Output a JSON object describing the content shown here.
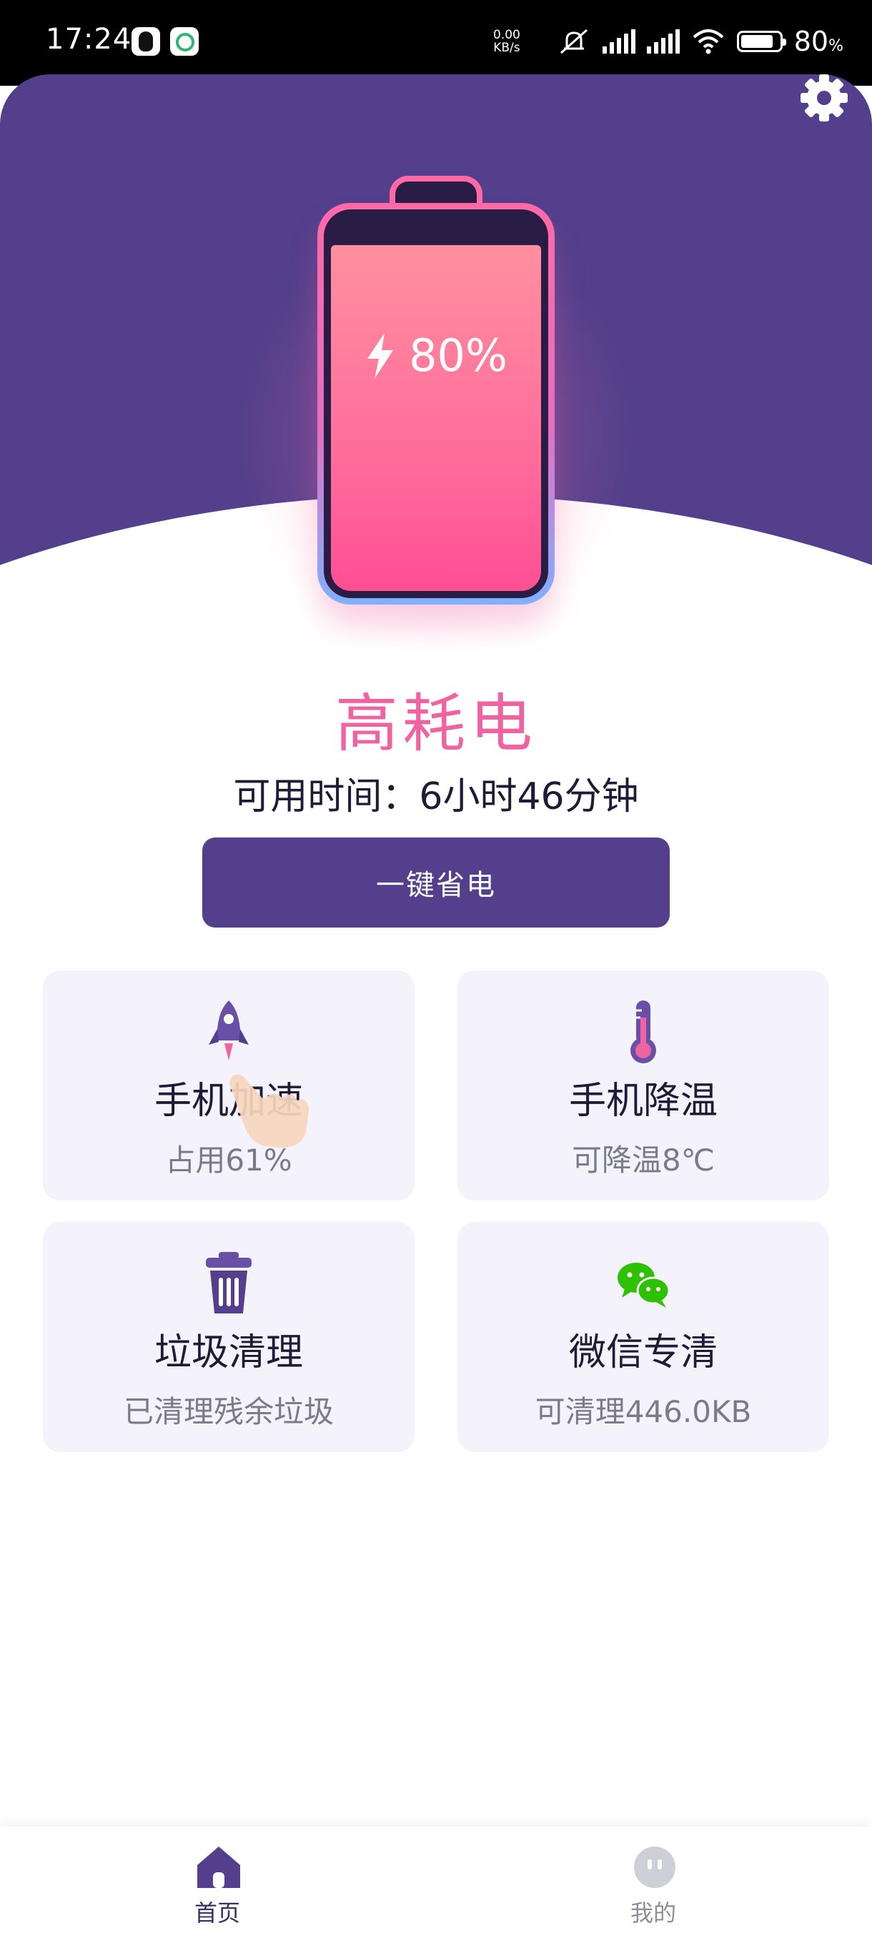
{
  "status_bar": {
    "time": "17:24",
    "net_speed_value": "0.00",
    "net_speed_unit": "KB/s",
    "battery_percent": "80",
    "battery_percent_unit": "%",
    "battery_level": 0.8
  },
  "header": {
    "settings_icon": "gear-icon",
    "battery_display": "80%",
    "battery_level": 0.8,
    "colors": {
      "header_bg": "#533f8c",
      "accent": "#f063a1"
    }
  },
  "summary": {
    "status": "高耗电",
    "available_time": "可用时间：6小时46分钟",
    "save_button_label": "一键省电"
  },
  "cards": [
    {
      "icon": "rocket-icon",
      "title": "手机加速",
      "subtitle": "占用61%"
    },
    {
      "icon": "thermometer-icon",
      "title": "手机降温",
      "subtitle": "可降温8℃"
    },
    {
      "icon": "trash-icon",
      "title": "垃圾清理",
      "subtitle": "已清理残余垃圾"
    },
    {
      "icon": "wechat-icon",
      "title": "微信专清",
      "subtitle": "可清理446.0KB"
    }
  ],
  "bottom_nav": [
    {
      "icon": "home-icon",
      "label": "首页",
      "active": true
    },
    {
      "icon": "profile-face-icon",
      "label": "我的",
      "active": false
    }
  ]
}
